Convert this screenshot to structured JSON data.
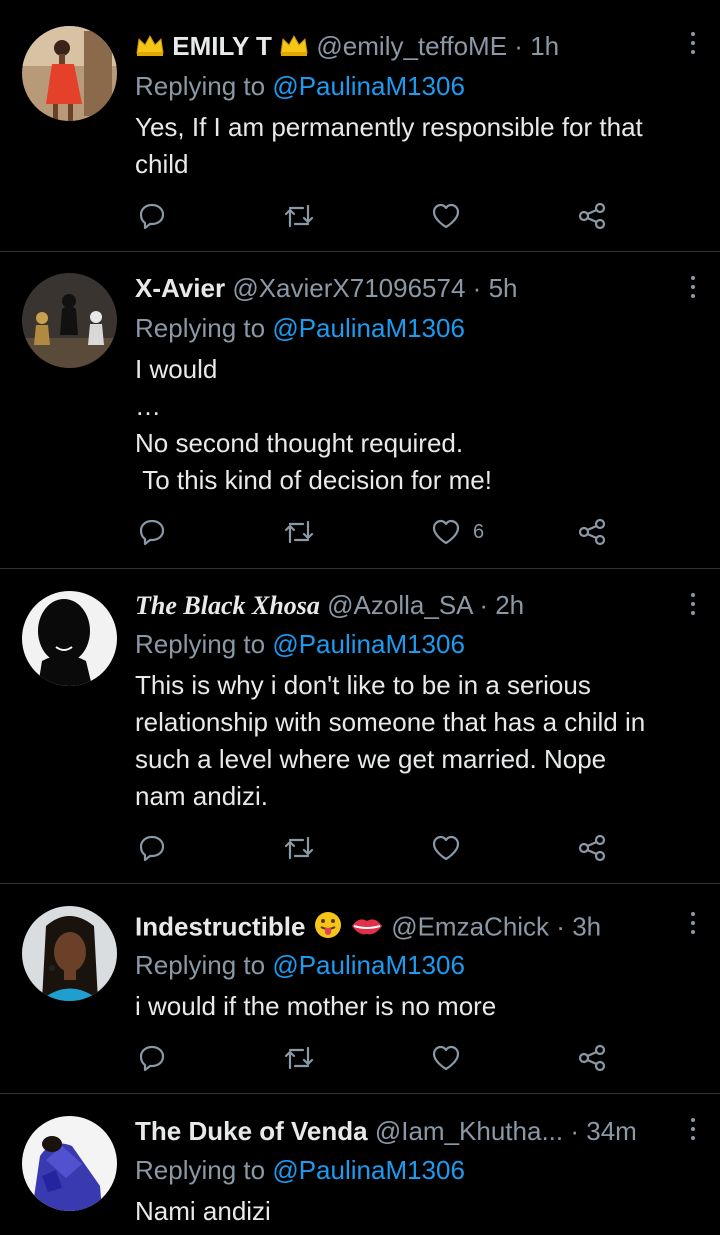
{
  "colors": {
    "background": "#000000",
    "text": "#e7e9ea",
    "muted": "#8b98a5",
    "link": "#1d9bf0",
    "divider": "#2f3336"
  },
  "tweets": [
    {
      "name": "EMILY T",
      "name_prefix_emoji": "crown-emoji",
      "name_suffix_emoji": "crown-emoji",
      "handle": "@emily_teffoME",
      "dot": "·",
      "time": "1h",
      "replying_prefix": "Replying to ",
      "replying_to": "@PaulinaM1306",
      "text": "Yes, If I am permanently responsible for that\nchild",
      "like_count": "",
      "avatar": "woman-in-red-dress-avatar"
    },
    {
      "name": "X-Avier",
      "handle": "@XavierX71096574",
      "dot": "·",
      "time": "5h",
      "replying_prefix": "Replying to ",
      "replying_to": "@PaulinaM1306",
      "text": "I would\n…\nNo second thought required.\n To this kind of decision for me!",
      "like_count": "6",
      "avatar": "thinker-statues-avatar"
    },
    {
      "name": "The Black Xhosa",
      "handle": "@Azolla_SA",
      "dot": "·",
      "time": "2h",
      "replying_prefix": "Replying to ",
      "replying_to": "@PaulinaM1306",
      "text": "This is why i don't like to be in a serious\nrelationship with someone that has a child in\nsuch a level where we get married. Nope\nnam andizi.",
      "like_count": "",
      "avatar": "silhouette-avatar"
    },
    {
      "name": "Indestructible",
      "name_suffix_emoji": "tongue-face-emoji lips-emoji",
      "handle": "@EmzaChick",
      "dot": "·",
      "time": "3h",
      "replying_prefix": "Replying to ",
      "replying_to": "@PaulinaM1306",
      "text": "i would if the mother is no more",
      "like_count": "",
      "avatar": "woman-portrait-avatar"
    },
    {
      "name": "The Duke of Venda",
      "handle": "@Iam_Khutha...",
      "dot": "·",
      "time": "34m",
      "replying_prefix": "Replying to ",
      "replying_to": "@PaulinaM1306",
      "text": "Nami andizi",
      "like_count": "",
      "avatar": "person-in-blue-avatar"
    }
  ]
}
